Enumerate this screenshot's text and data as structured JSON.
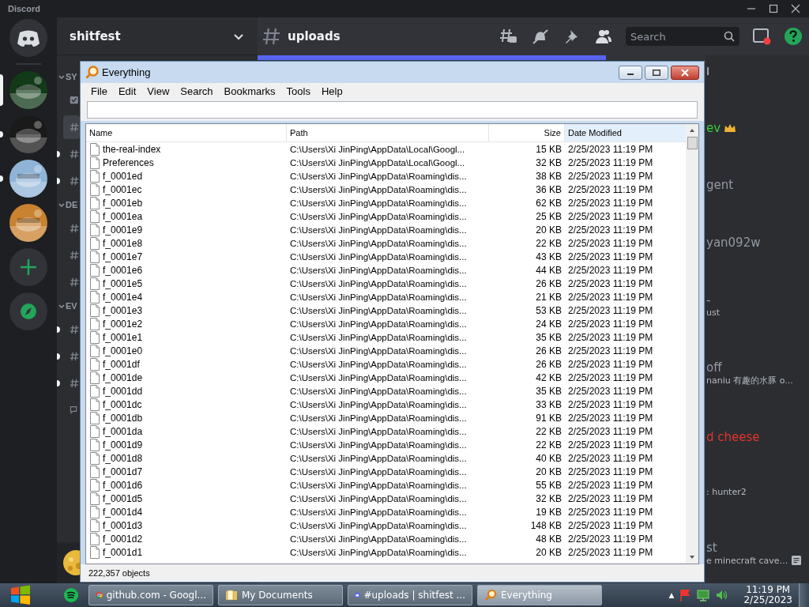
{
  "app": {
    "title": "Discord"
  },
  "servers": [
    {
      "kind": "home",
      "selected": false,
      "unread": false
    },
    {
      "kind": "picture",
      "selected": true,
      "unread": false
    },
    {
      "kind": "picture",
      "selected": false,
      "unread": true
    },
    {
      "kind": "picture",
      "selected": false,
      "unread": true
    },
    {
      "kind": "picture",
      "selected": false,
      "unread": false
    },
    {
      "kind": "add",
      "selected": false,
      "unread": false
    },
    {
      "kind": "explore",
      "selected": false,
      "unread": false
    }
  ],
  "guild": {
    "name": "shitfest"
  },
  "channel_categories": [
    {
      "label": "SY",
      "channels": [
        {
          "kind": "rules",
          "selected": false,
          "unread": false
        },
        {
          "kind": "text",
          "selected": true,
          "unread": false
        },
        {
          "kind": "text",
          "selected": false,
          "unread": true
        },
        {
          "kind": "text",
          "selected": false,
          "unread": true
        }
      ]
    },
    {
      "label": "DE",
      "channels": [
        {
          "kind": "text",
          "selected": false,
          "unread": false
        },
        {
          "kind": "text",
          "selected": false,
          "unread": false
        },
        {
          "kind": "text",
          "selected": false,
          "unread": false
        }
      ]
    },
    {
      "label": "EV",
      "channels": [
        {
          "kind": "text",
          "selected": false,
          "unread": true
        },
        {
          "kind": "text",
          "selected": false,
          "unread": true
        },
        {
          "kind": "text",
          "selected": false,
          "unread": true
        },
        {
          "kind": "forum",
          "selected": false,
          "unread": false
        }
      ]
    }
  ],
  "chat_header": {
    "channel": "uploads",
    "search": {
      "placeholder": "Search"
    }
  },
  "members": [
    {
      "name": "l",
      "kind": "header"
    },
    {
      "name": "ev",
      "kind": "member",
      "color": "#3ec93e",
      "crown": true
    },
    {
      "name": "gent",
      "kind": "member"
    },
    {
      "name": "yan092w",
      "kind": "member"
    },
    {
      "name": "-",
      "kind": "member",
      "status": "ust"
    },
    {
      "name": "off",
      "kind": "member",
      "status": "naniu 有趣的水豚 o..."
    },
    {
      "name": "d cheese",
      "kind": "member",
      "color": "#e2352f"
    },
    {
      "kind": "member",
      "status": ": hunter2"
    },
    {
      "name": "st",
      "kind": "member",
      "status": "e minecraft cave...",
      "note": true
    }
  ],
  "everything": {
    "title": "Everything",
    "menu": [
      "File",
      "Edit",
      "View",
      "Search",
      "Bookmarks",
      "Tools",
      "Help"
    ],
    "columns": [
      "Name",
      "Path",
      "Size",
      "Date Modified"
    ],
    "rows": [
      {
        "name": "the-real-index",
        "path": "C:\\Users\\Xi JinPing\\AppData\\Local\\Googl...",
        "size": "15 KB",
        "modified": "2/25/2023 11:19 PM"
      },
      {
        "name": "Preferences",
        "path": "C:\\Users\\Xi JinPing\\AppData\\Local\\Googl...",
        "size": "32 KB",
        "modified": "2/25/2023 11:19 PM"
      },
      {
        "name": "f_0001ed",
        "path": "C:\\Users\\Xi JinPing\\AppData\\Roaming\\dis...",
        "size": "38 KB",
        "modified": "2/25/2023 11:19 PM"
      },
      {
        "name": "f_0001ec",
        "path": "C:\\Users\\Xi JinPing\\AppData\\Roaming\\dis...",
        "size": "36 KB",
        "modified": "2/25/2023 11:19 PM"
      },
      {
        "name": "f_0001eb",
        "path": "C:\\Users\\Xi JinPing\\AppData\\Roaming\\dis...",
        "size": "62 KB",
        "modified": "2/25/2023 11:19 PM"
      },
      {
        "name": "f_0001ea",
        "path": "C:\\Users\\Xi JinPing\\AppData\\Roaming\\dis...",
        "size": "25 KB",
        "modified": "2/25/2023 11:19 PM"
      },
      {
        "name": "f_0001e9",
        "path": "C:\\Users\\Xi JinPing\\AppData\\Roaming\\dis...",
        "size": "20 KB",
        "modified": "2/25/2023 11:19 PM"
      },
      {
        "name": "f_0001e8",
        "path": "C:\\Users\\Xi JinPing\\AppData\\Roaming\\dis...",
        "size": "22 KB",
        "modified": "2/25/2023 11:19 PM"
      },
      {
        "name": "f_0001e7",
        "path": "C:\\Users\\Xi JinPing\\AppData\\Roaming\\dis...",
        "size": "43 KB",
        "modified": "2/25/2023 11:19 PM"
      },
      {
        "name": "f_0001e6",
        "path": "C:\\Users\\Xi JinPing\\AppData\\Roaming\\dis...",
        "size": "44 KB",
        "modified": "2/25/2023 11:19 PM"
      },
      {
        "name": "f_0001e5",
        "path": "C:\\Users\\Xi JinPing\\AppData\\Roaming\\dis...",
        "size": "26 KB",
        "modified": "2/25/2023 11:19 PM"
      },
      {
        "name": "f_0001e4",
        "path": "C:\\Users\\Xi JinPing\\AppData\\Roaming\\dis...",
        "size": "21 KB",
        "modified": "2/25/2023 11:19 PM"
      },
      {
        "name": "f_0001e3",
        "path": "C:\\Users\\Xi JinPing\\AppData\\Roaming\\dis...",
        "size": "53 KB",
        "modified": "2/25/2023 11:19 PM"
      },
      {
        "name": "f_0001e2",
        "path": "C:\\Users\\Xi JinPing\\AppData\\Roaming\\dis...",
        "size": "24 KB",
        "modified": "2/25/2023 11:19 PM"
      },
      {
        "name": "f_0001e1",
        "path": "C:\\Users\\Xi JinPing\\AppData\\Roaming\\dis...",
        "size": "35 KB",
        "modified": "2/25/2023 11:19 PM"
      },
      {
        "name": "f_0001e0",
        "path": "C:\\Users\\Xi JinPing\\AppData\\Roaming\\dis...",
        "size": "26 KB",
        "modified": "2/25/2023 11:19 PM"
      },
      {
        "name": "f_0001df",
        "path": "C:\\Users\\Xi JinPing\\AppData\\Roaming\\dis...",
        "size": "26 KB",
        "modified": "2/25/2023 11:19 PM"
      },
      {
        "name": "f_0001de",
        "path": "C:\\Users\\Xi JinPing\\AppData\\Roaming\\dis...",
        "size": "42 KB",
        "modified": "2/25/2023 11:19 PM"
      },
      {
        "name": "f_0001dd",
        "path": "C:\\Users\\Xi JinPing\\AppData\\Roaming\\dis...",
        "size": "35 KB",
        "modified": "2/25/2023 11:19 PM"
      },
      {
        "name": "f_0001dc",
        "path": "C:\\Users\\Xi JinPing\\AppData\\Roaming\\dis...",
        "size": "33 KB",
        "modified": "2/25/2023 11:19 PM"
      },
      {
        "name": "f_0001db",
        "path": "C:\\Users\\Xi JinPing\\AppData\\Roaming\\dis...",
        "size": "91 KB",
        "modified": "2/25/2023 11:19 PM"
      },
      {
        "name": "f_0001da",
        "path": "C:\\Users\\Xi JinPing\\AppData\\Roaming\\dis...",
        "size": "22 KB",
        "modified": "2/25/2023 11:19 PM"
      },
      {
        "name": "f_0001d9",
        "path": "C:\\Users\\Xi JinPing\\AppData\\Roaming\\dis...",
        "size": "22 KB",
        "modified": "2/25/2023 11:19 PM"
      },
      {
        "name": "f_0001d8",
        "path": "C:\\Users\\Xi JinPing\\AppData\\Roaming\\dis...",
        "size": "40 KB",
        "modified": "2/25/2023 11:19 PM"
      },
      {
        "name": "f_0001d7",
        "path": "C:\\Users\\Xi JinPing\\AppData\\Roaming\\dis...",
        "size": "20 KB",
        "modified": "2/25/2023 11:19 PM"
      },
      {
        "name": "f_0001d6",
        "path": "C:\\Users\\Xi JinPing\\AppData\\Roaming\\dis...",
        "size": "55 KB",
        "modified": "2/25/2023 11:19 PM"
      },
      {
        "name": "f_0001d5",
        "path": "C:\\Users\\Xi JinPing\\AppData\\Roaming\\dis...",
        "size": "32 KB",
        "modified": "2/25/2023 11:19 PM"
      },
      {
        "name": "f_0001d4",
        "path": "C:\\Users\\Xi JinPing\\AppData\\Roaming\\dis...",
        "size": "19 KB",
        "modified": "2/25/2023 11:19 PM"
      },
      {
        "name": "f_0001d3",
        "path": "C:\\Users\\Xi JinPing\\AppData\\Roaming\\dis...",
        "size": "148 KB",
        "modified": "2/25/2023 11:19 PM"
      },
      {
        "name": "f_0001d2",
        "path": "C:\\Users\\Xi JinPing\\AppData\\Roaming\\dis...",
        "size": "48 KB",
        "modified": "2/25/2023 11:19 PM"
      },
      {
        "name": "f_0001d1",
        "path": "C:\\Users\\Xi JinPing\\AppData\\Roaming\\dis...",
        "size": "20 KB",
        "modified": "2/25/2023 11:19 PM"
      }
    ],
    "status_bar": "222,357 objects"
  },
  "taskbar": {
    "tasks": [
      {
        "kind": "chrome",
        "label": "github.com - Googl...",
        "selected": false
      },
      {
        "kind": "folder",
        "label": "My Documents",
        "selected": false
      },
      {
        "kind": "discord",
        "label": "#uploads | shitfest ...",
        "selected": false
      },
      {
        "kind": "everything",
        "label": "Everything",
        "selected": true
      }
    ],
    "tray_arrow": "▲",
    "time": "11:19 PM",
    "date": "2/25/2023"
  }
}
